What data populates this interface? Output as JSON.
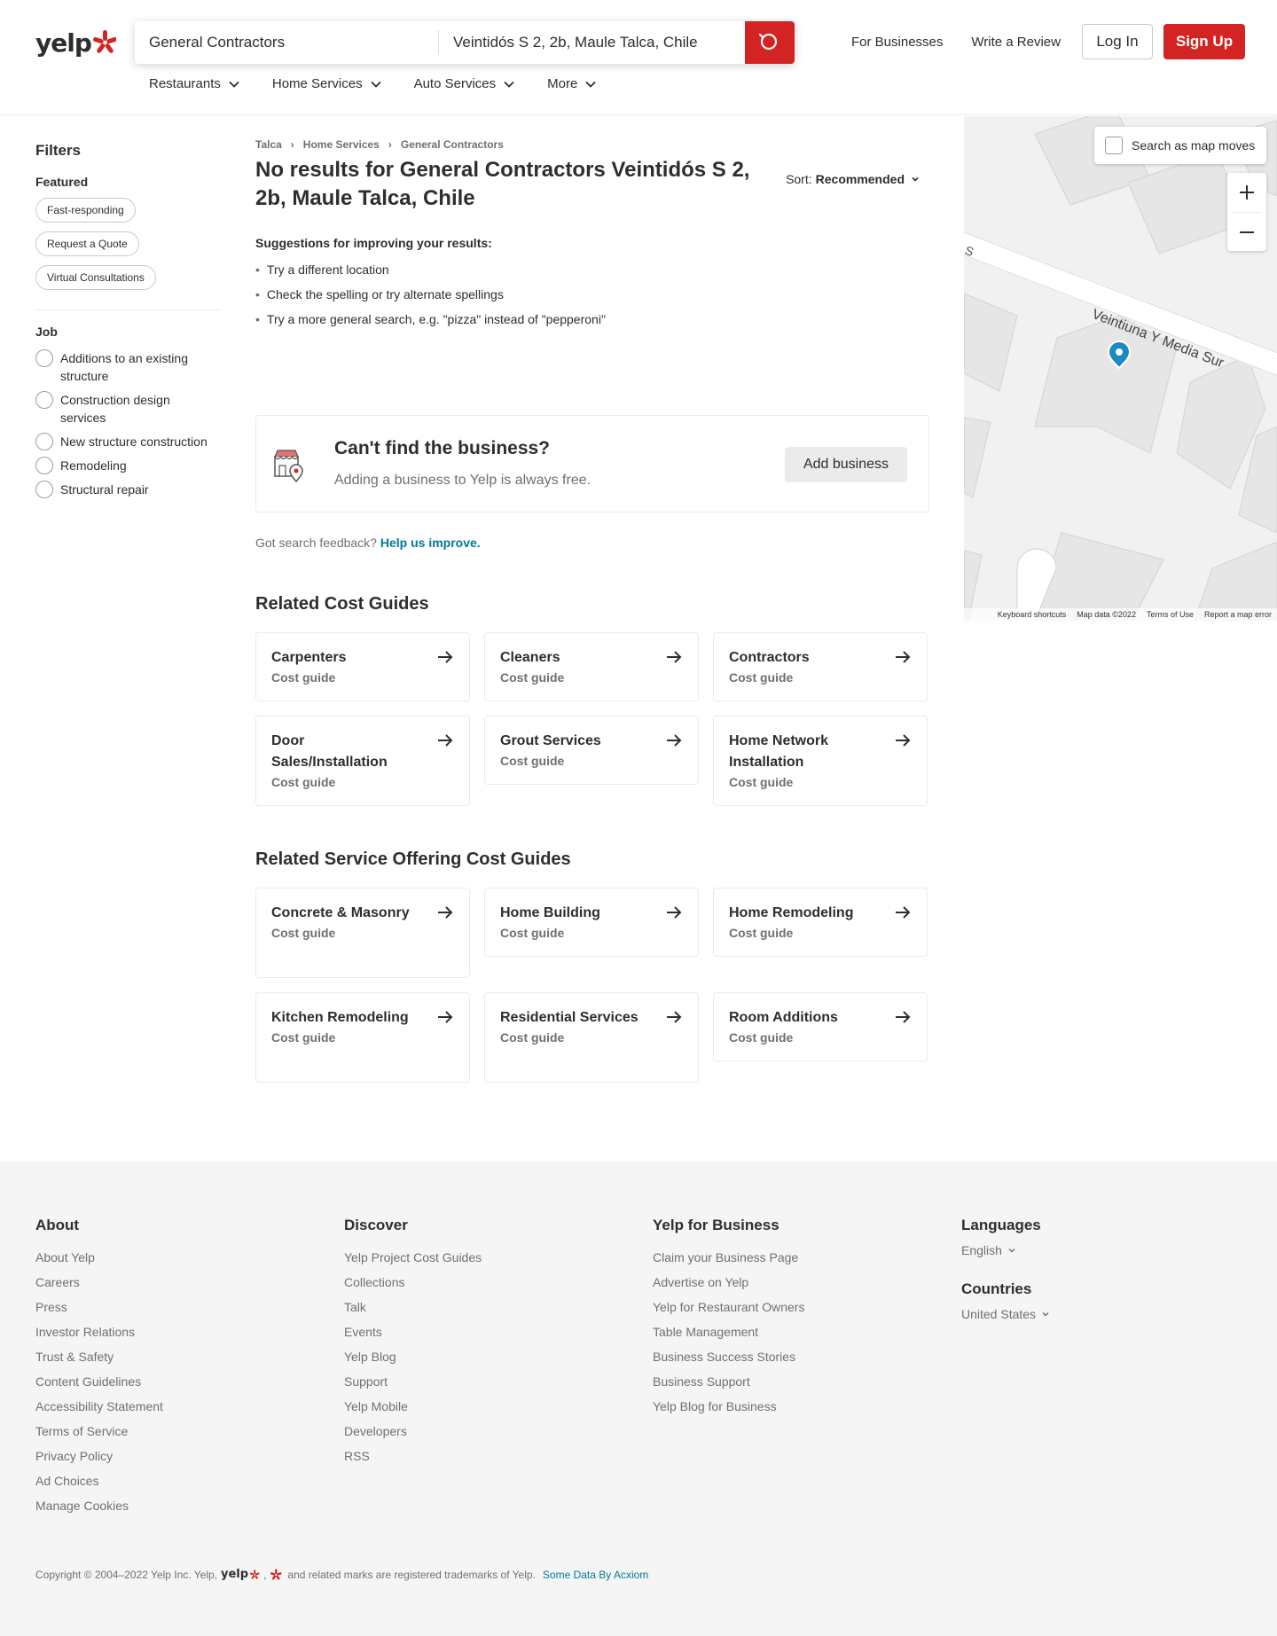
{
  "header": {
    "logo_text": "yelp",
    "search_find": "General Contractors",
    "search_near": "Veintidós S 2, 2b, Maule Talca, Chile",
    "links": [
      "For Businesses",
      "Write a Review"
    ],
    "login_label": "Log In",
    "signup_label": "Sign Up",
    "categories": [
      "Restaurants",
      "Home Services",
      "Auto Services",
      "More"
    ]
  },
  "filters": {
    "title": "Filters",
    "featured_label": "Featured",
    "featured_pills": [
      "Fast-responding",
      "Request a Quote",
      "Virtual Consultations"
    ],
    "job_label": "Job",
    "job_items": [
      "Additions to an existing structure",
      "Construction design services",
      "New structure construction",
      "Remodeling",
      "Structural repair"
    ]
  },
  "main": {
    "breadcrumbs": [
      "Talca",
      "Home Services",
      "General Contractors"
    ],
    "title": "No results for General Contractors Veintidós S 2, 2b, Maule Talca, Chile",
    "sort_label": "Sort:",
    "sort_value": "Recommended",
    "suggestions_title": "Suggestions for improving your results:",
    "suggestions": [
      "Try a different location",
      "Check the spelling or try alternate spellings",
      "Try a more general search, e.g. \"pizza\" instead of \"pepperoni\""
    ],
    "cant_find_title": "Can't find the business?",
    "cant_find_sub": "Adding a business to Yelp is always free.",
    "add_business_label": "Add business",
    "feedback_text": "Got search feedback?",
    "feedback_link": "Help us improve.",
    "related_title": "Related Cost Guides",
    "related_guides": [
      {
        "name": "Carpenters",
        "sub": "Cost guide"
      },
      {
        "name": "Cleaners",
        "sub": "Cost guide"
      },
      {
        "name": "Contractors",
        "sub": "Cost guide"
      },
      {
        "name": "Door Sales/Installation",
        "sub": "Cost guide"
      },
      {
        "name": "Grout Services",
        "sub": "Cost guide"
      },
      {
        "name": "Home Network Installation",
        "sub": "Cost guide"
      }
    ],
    "service_title": "Related Service Offering Cost Guides",
    "service_guides": [
      {
        "name": "Concrete & Masonry",
        "sub": "Cost guide"
      },
      {
        "name": "Home Building",
        "sub": "Cost guide"
      },
      {
        "name": "Home Remodeling",
        "sub": "Cost guide"
      },
      {
        "name": "Kitchen Remodeling",
        "sub": "Cost guide"
      },
      {
        "name": "Residential Services",
        "sub": "Cost guide"
      },
      {
        "name": "Room Additions",
        "sub": "Cost guide"
      }
    ]
  },
  "map": {
    "search_as_moves": "Search as map moves",
    "street_label": "Veintiuna Y Media Sur",
    "footer": [
      "Keyboard shortcuts",
      "Map data ©2022",
      "Terms of Use",
      "Report a map error"
    ]
  },
  "footer": {
    "about_title": "About",
    "about_links": [
      "About Yelp",
      "Careers",
      "Press",
      "Investor Relations",
      "Trust & Safety",
      "Content Guidelines",
      "Accessibility Statement",
      "Terms of Service",
      "Privacy Policy",
      "Ad Choices",
      "Manage Cookies"
    ],
    "discover_title": "Discover",
    "discover_links": [
      "Yelp Project Cost Guides",
      "Collections",
      "Talk",
      "Events",
      "Yelp Blog",
      "Support",
      "Yelp Mobile",
      "Developers",
      "RSS"
    ],
    "business_title": "Yelp for Business",
    "business_links": [
      "Claim your Business Page",
      "Advertise on Yelp",
      "Yelp for Restaurant Owners",
      "Table Management",
      "Business Success Stories",
      "Business Support",
      "Yelp Blog for Business"
    ],
    "languages_title": "Languages",
    "language_value": "English",
    "countries_title": "Countries",
    "country_value": "United States",
    "copyright": "Copyright © 2004–2022 Yelp Inc. Yelp,",
    "copyright_tail": "and related marks are registered trademarks of Yelp.",
    "acxiom": "Some Data By Acxiom"
  },
  "colors": {
    "brand_red": "#d32323",
    "link_teal": "#027a97"
  }
}
